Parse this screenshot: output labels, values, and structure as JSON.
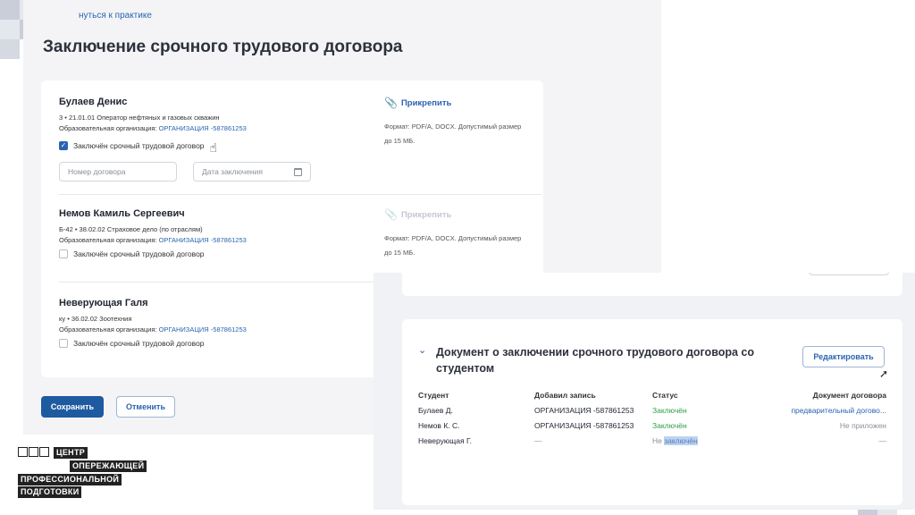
{
  "back_link": "нуться к практике",
  "page_title": "Заключение срочного трудового договора",
  "students": [
    {
      "name": "Булаев Денис",
      "spec": "3  •  21.01.01 Оператор нефтяных и газовых скважин",
      "org_prefix": "Образовательная организация:",
      "org_link": "ОРГАНИЗАЦИЯ -587861253",
      "checkbox_label": "Заключён срочный трудовой договор",
      "checked": true,
      "contract_number_placeholder": "Номер договора",
      "contract_date_placeholder": "Дата заключения",
      "attach_label": "Прикрепить",
      "attach_hint": "Формат: PDF/A, DOCX. Допустимый размер до 15 МБ."
    },
    {
      "name": "Немов Камиль Сергеевич",
      "spec": "Б-42  •  38.02.02 Страховое дело (по отраслям)",
      "org_prefix": "Образовательная организация:",
      "org_link": "ОРГАНИЗАЦИЯ -587861253",
      "checkbox_label": "Заключён срочный трудовой договор",
      "checked": false,
      "attach_label": "Прикрепить",
      "attach_hint": "Формат: PDF/A, DOCX. Допустимый размер до 15 МБ."
    },
    {
      "name": "Неверующая Галя",
      "spec": "ку  •  36.02.02 Зоотехния",
      "org_prefix": "Образовательная организация:",
      "org_link": "ОРГАНИЗАЦИЯ -587861253",
      "checkbox_label": "Заключён срочный трудовой договор",
      "checked": false
    }
  ],
  "buttons": {
    "save": "Сохранить",
    "cancel": "Отменить",
    "edit": "Редактировать"
  },
  "doc_section": {
    "title": "Документ о заключении срочного трудового договора со студентом",
    "columns": [
      "Студент",
      "Добавил запись",
      "Статус",
      "Документ договора"
    ],
    "rows": [
      {
        "student": "Булаев Д.",
        "added_by": "ОРГАНИЗАЦИЯ -587861253",
        "status": "Заключён",
        "document": "предварительный догово..."
      },
      {
        "student": "Немов К. С.",
        "added_by": "ОРГАНИЗАЦИЯ -587861253",
        "status": "Заключён",
        "document": "Не приложен"
      },
      {
        "student": "Неверующая Г.",
        "added_by": "—",
        "status_prefix": "Не ",
        "status_highlight": "заключён",
        "document": "—"
      }
    ]
  },
  "logo": {
    "line1": "ЦЕНТР",
    "line2": "ОПЕРЕЖАЮЩЕЙ",
    "line3": "ПРОФЕССИОНАЛЬНОЙ",
    "line4": "ПОДГОТОВКИ"
  },
  "colors": {
    "accent": "#2a64b0",
    "primary_button": "#1e5aa0",
    "success": "#2e9e4a"
  }
}
